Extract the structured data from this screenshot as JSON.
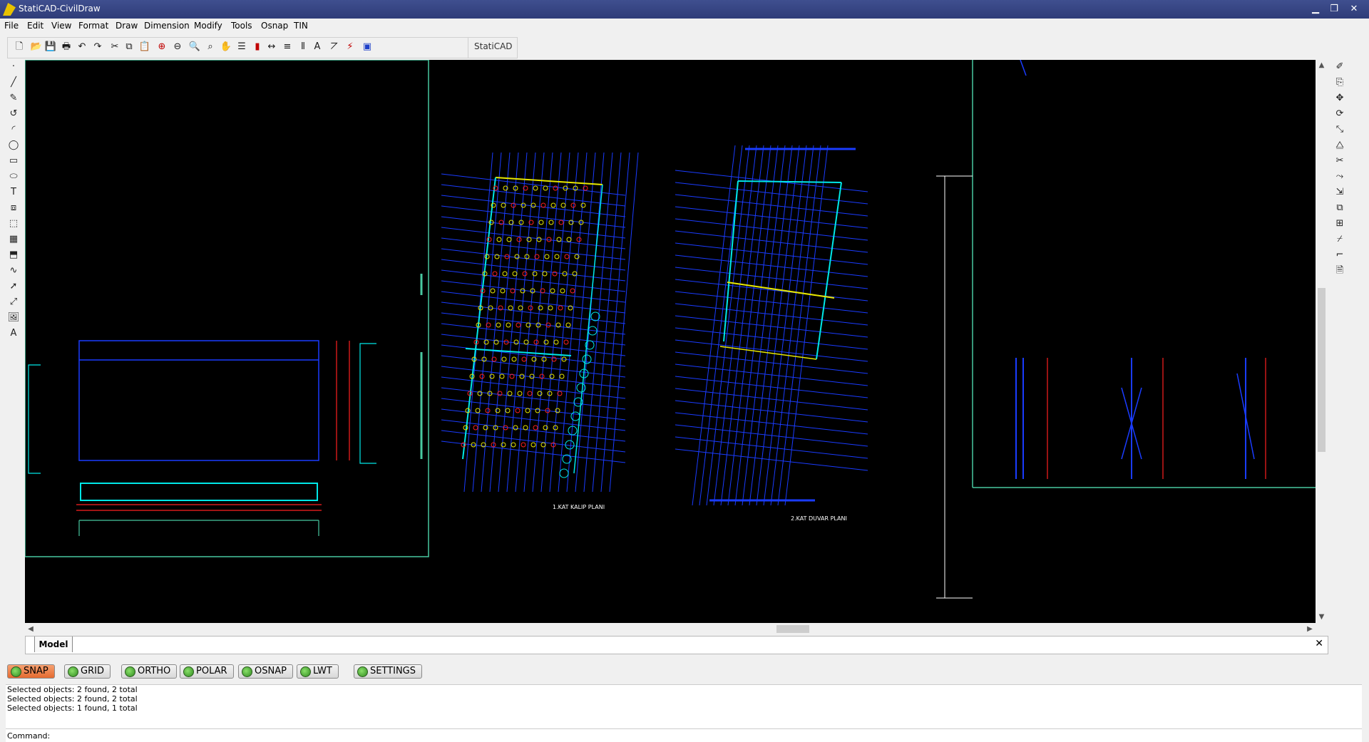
{
  "window": {
    "title": "StatiCAD-CivilDraw",
    "minimize_glyph": "▁",
    "restore_glyph": "❐",
    "close_glyph": "✕"
  },
  "menu": [
    {
      "id": "file",
      "label": "File"
    },
    {
      "id": "edit",
      "label": "Edit"
    },
    {
      "id": "view",
      "label": "View"
    },
    {
      "id": "format",
      "label": "Format"
    },
    {
      "id": "draw",
      "label": "Draw"
    },
    {
      "id": "dimension",
      "label": "Dimension"
    },
    {
      "id": "modify",
      "label": "Modify"
    },
    {
      "id": "tools",
      "label": "Tools"
    },
    {
      "id": "osnap",
      "label": "Osnap"
    },
    {
      "id": "tin",
      "label": "TIN"
    }
  ],
  "toolbar_buttons": [
    {
      "name": "new-file-icon",
      "glyph": "🗋",
      "tone": ""
    },
    {
      "name": "open-folder-icon",
      "glyph": "📂",
      "tone": ""
    },
    {
      "name": "save-icon",
      "glyph": "💾",
      "tone": ""
    },
    {
      "name": "print-icon",
      "glyph": "🖶",
      "tone": ""
    },
    {
      "name": "undo-icon",
      "glyph": "↶",
      "tone": ""
    },
    {
      "name": "redo-icon",
      "glyph": "↷",
      "tone": ""
    },
    {
      "name": "cut-icon",
      "glyph": "✂",
      "tone": ""
    },
    {
      "name": "copy-icon",
      "glyph": "⧉",
      "tone": ""
    },
    {
      "name": "paste-icon",
      "glyph": "📋",
      "tone": ""
    },
    {
      "name": "zoom-in-icon",
      "glyph": "⊕",
      "tone": "red"
    },
    {
      "name": "zoom-out-icon",
      "glyph": "⊖",
      "tone": ""
    },
    {
      "name": "zoom-window-icon",
      "glyph": "🔍",
      "tone": ""
    },
    {
      "name": "zoom-extents-icon",
      "glyph": "⌕",
      "tone": ""
    },
    {
      "name": "pan-icon",
      "glyph": "✋",
      "tone": ""
    },
    {
      "name": "layers-icon",
      "glyph": "☰",
      "tone": ""
    },
    {
      "name": "color-bars-icon",
      "glyph": "▮",
      "tone": "red"
    },
    {
      "name": "dimension-linear-icon",
      "glyph": "↔",
      "tone": ""
    },
    {
      "name": "hatch-icon",
      "glyph": "≡",
      "tone": ""
    },
    {
      "name": "columns-icon",
      "glyph": "⫴",
      "tone": ""
    },
    {
      "name": "text-style-icon",
      "glyph": "A",
      "tone": ""
    },
    {
      "name": "measure-icon",
      "glyph": "⦢",
      "tone": ""
    },
    {
      "name": "purge-icon",
      "glyph": "⚡",
      "tone": "red"
    },
    {
      "name": "statics-module-icon",
      "glyph": "▣",
      "tone": "blue"
    }
  ],
  "statiCAD_toolbar_label": "StatiCAD",
  "left_tools": [
    {
      "name": "point-tool-icon",
      "glyph": "·"
    },
    {
      "name": "line-tool-icon",
      "glyph": "╱"
    },
    {
      "name": "polyline-tool-icon",
      "glyph": "✎"
    },
    {
      "name": "rotate-tool-icon",
      "glyph": "↺"
    },
    {
      "name": "arc-tool-icon",
      "glyph": "◜"
    },
    {
      "name": "circle-tool-icon",
      "glyph": "◯"
    },
    {
      "name": "rectangle-tool-icon",
      "glyph": "▭"
    },
    {
      "name": "ellipse-tool-icon",
      "glyph": "⬭"
    },
    {
      "name": "text-tool-icon",
      "glyph": "T"
    },
    {
      "name": "block-tool-icon",
      "glyph": "⧈"
    },
    {
      "name": "insert-block-icon",
      "glyph": "⬚"
    },
    {
      "name": "hatch-tool-icon",
      "glyph": "▦"
    },
    {
      "name": "region-tool-icon",
      "glyph": "⬒"
    },
    {
      "name": "spline-tool-icon",
      "glyph": "∿"
    },
    {
      "name": "ray-tool-icon",
      "glyph": "➚"
    },
    {
      "name": "xline-tool-icon",
      "glyph": "⤢"
    },
    {
      "name": "image-tool-icon",
      "glyph": "🖼"
    },
    {
      "name": "multiline-text-icon",
      "glyph": "A"
    }
  ],
  "right_tools": [
    {
      "name": "erase-tool-icon",
      "glyph": "✐"
    },
    {
      "name": "copy-object-icon",
      "glyph": "⎘"
    },
    {
      "name": "move-tool-icon",
      "glyph": "✥"
    },
    {
      "name": "rotate-object-icon",
      "glyph": "⟳"
    },
    {
      "name": "scale-tool-icon",
      "glyph": "⤡"
    },
    {
      "name": "mirror-tool-icon",
      "glyph": "⧋"
    },
    {
      "name": "trim-tool-icon",
      "glyph": "✂"
    },
    {
      "name": "extend-tool-icon",
      "glyph": "⤳"
    },
    {
      "name": "stretch-tool-icon",
      "glyph": "⇲"
    },
    {
      "name": "offset-tool-icon",
      "glyph": "⧉"
    },
    {
      "name": "array-tool-icon",
      "glyph": "⊞"
    },
    {
      "name": "break-tool-icon",
      "glyph": "⌿"
    },
    {
      "name": "fillet-tool-icon",
      "glyph": "⌐"
    },
    {
      "name": "properties-tool-icon",
      "glyph": "🗎"
    }
  ],
  "drawing": {
    "plan1_title": "1.KAT KALIP PLANI",
    "plan2_title": "2.KAT DUVAR PLANI",
    "colors": {
      "background": "#000000",
      "frame": "#48c8a0",
      "plan_lines": "#1a3cff",
      "red": "#ff2020",
      "yellow": "#e8e800",
      "cyan": "#00e8e8",
      "white": "#ffffff"
    }
  },
  "tabs": {
    "model": "Model",
    "close_glyph": "✕"
  },
  "status_buttons": [
    {
      "id": "snap",
      "label": "SNAP",
      "active": true
    },
    {
      "id": "grid",
      "label": "GRID",
      "active": false
    },
    {
      "id": "ortho",
      "label": "ORTHO",
      "active": false
    },
    {
      "id": "polar",
      "label": "POLAR",
      "active": false
    },
    {
      "id": "osnap",
      "label": "OSNAP",
      "active": false
    },
    {
      "id": "lwt",
      "label": "LWT",
      "active": false
    },
    {
      "id": "settings",
      "label": "SETTINGS",
      "active": false
    }
  ],
  "command_history": [
    "Selected objects: 2 found, 2 total",
    "Selected objects: 2 found, 2 total",
    "Selected objects: 1 found, 1 total"
  ],
  "command": {
    "label": "Command:",
    "value": ""
  }
}
